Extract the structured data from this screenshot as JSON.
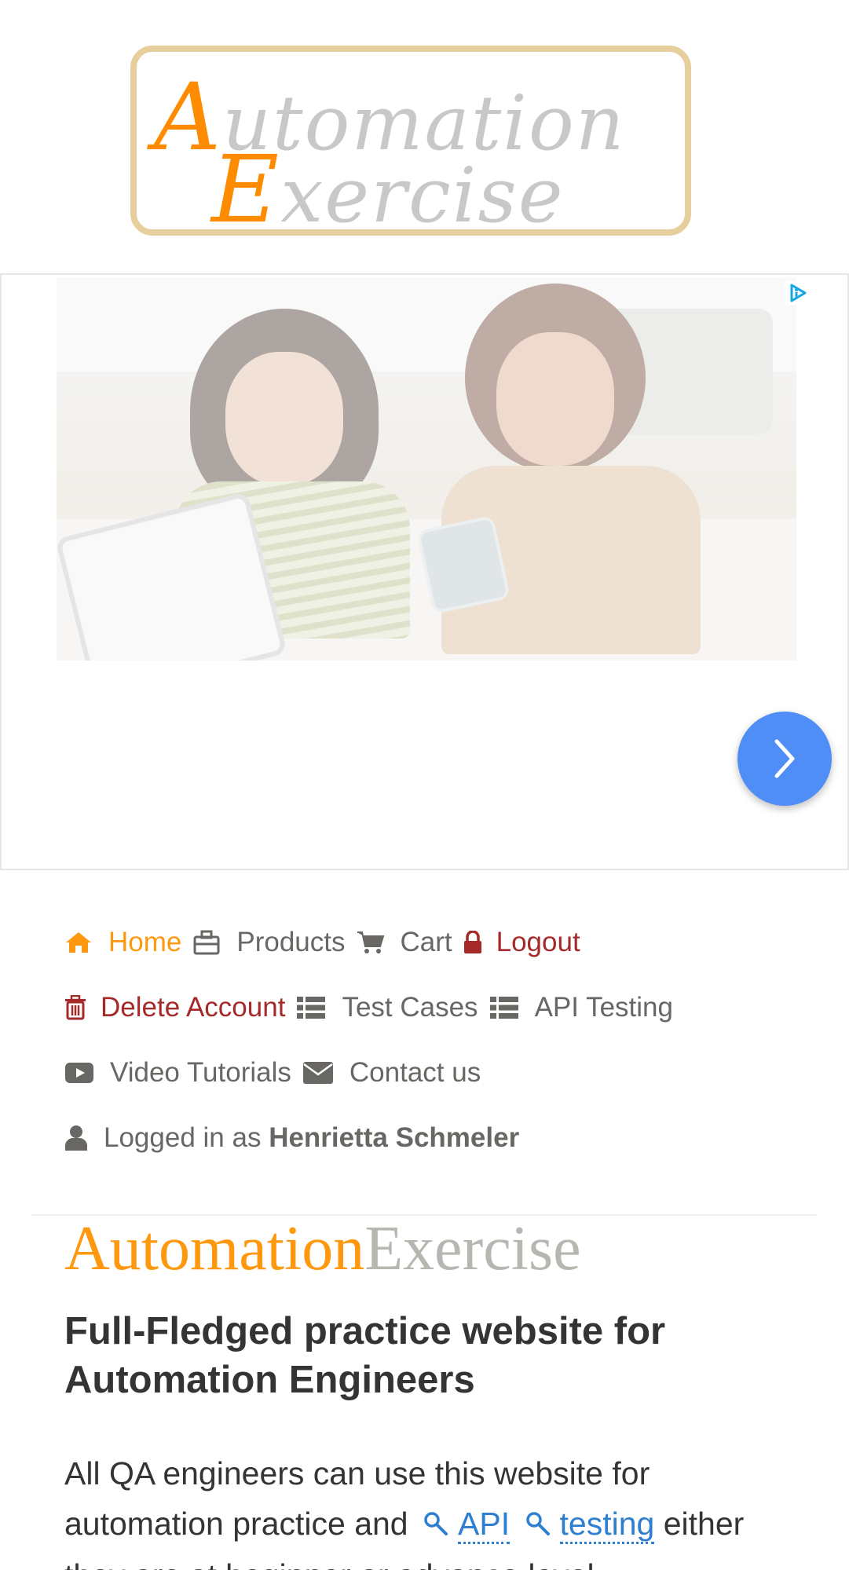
{
  "logo": {
    "line1_cap": "A",
    "line1_rest": "utomation",
    "line2_cap": "E",
    "line2_rest": "xercise"
  },
  "ad": {
    "choices_icon": "adchoices-icon",
    "next_icon": "chevron-right-icon",
    "accent_color": "#4f8ef7"
  },
  "nav": {
    "home": "Home",
    "products": "Products",
    "cart": "Cart",
    "logout": "Logout",
    "delete_account": "Delete Account",
    "test_cases": "Test Cases",
    "api_testing": "API Testing",
    "video_tutorials": "Video Tutorials",
    "contact_us": "Contact us",
    "logged_in_prefix": "Logged in as",
    "username": "Henrietta Schmeler"
  },
  "hero": {
    "brand_part1": "Automation",
    "brand_part2": "Exercise",
    "title": "Full-Fledged practice website for Automation Engineers",
    "text_before": "All QA engineers can use this website for automation practice and",
    "keyword1": "API",
    "keyword2": "testing",
    "text_after": "either they are at beginner or advance level"
  },
  "colors": {
    "brand_orange": "#fe980f",
    "danger_red": "#a52a2a",
    "link_blue": "#2f7fd1",
    "text_gray": "#696763"
  }
}
